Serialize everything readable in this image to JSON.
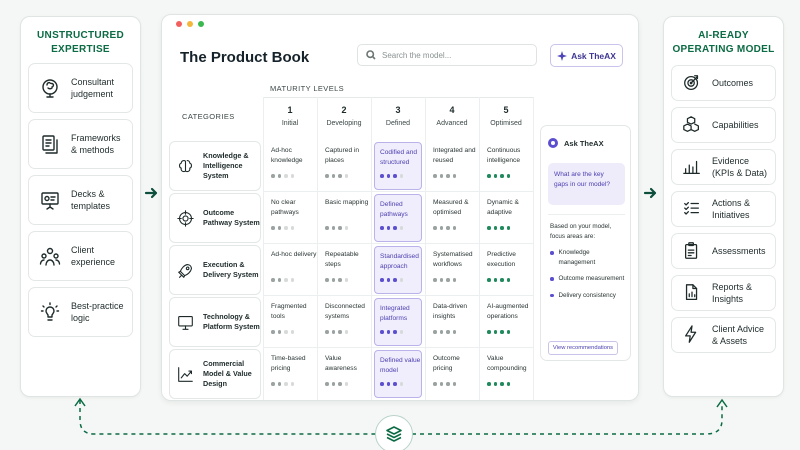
{
  "left_panel": {
    "title": "UNSTRUCTURED EXPERTISE",
    "items": [
      {
        "label": "Consultant judgement",
        "icon": "brain-head-icon"
      },
      {
        "label": "Frameworks & methods",
        "icon": "documents-icon"
      },
      {
        "label": "Decks & templates",
        "icon": "presentation-icon"
      },
      {
        "label": "Client experience",
        "icon": "people-icon"
      },
      {
        "label": "Best-practice logic",
        "icon": "lightbulb-icon"
      }
    ]
  },
  "right_panel": {
    "title": "AI-READY OPERATING MODEL",
    "items": [
      {
        "label": "Outcomes",
        "icon": "target-icon"
      },
      {
        "label": "Capabilities",
        "icon": "cubes-icon"
      },
      {
        "label": "Evidence (KPIs & Data)",
        "icon": "bar-chart-icon"
      },
      {
        "label": "Actions & Initiatives",
        "icon": "checklist-icon"
      },
      {
        "label": "Assessments",
        "icon": "clipboard-icon"
      },
      {
        "label": "Reports & Insights",
        "icon": "report-icon"
      },
      {
        "label": "Client Advice & Assets",
        "icon": "lightning-icon"
      }
    ]
  },
  "window": {
    "title": "The Product Book",
    "search_placeholder": "Search the model...",
    "ask_button": "Ask TheAX",
    "categories_header": "CATEGORIES",
    "maturity_header": "MATURITY LEVELS",
    "dot_colors": [
      "#f25f5c",
      "#f5b73b",
      "#3cb94e"
    ],
    "levels": [
      {
        "num": "1",
        "name": "Initial"
      },
      {
        "num": "2",
        "name": "Developing"
      },
      {
        "num": "3",
        "name": "Defined"
      },
      {
        "num": "4",
        "name": "Advanced"
      },
      {
        "num": "5",
        "name": "Optimised"
      }
    ],
    "highlight_level": 3,
    "rows": [
      {
        "category": "Knowledge & Intelligence System",
        "icon": "brain-icon",
        "cells": [
          "Ad-hoc knowledge",
          "Captured in places",
          "Codified and structured",
          "Integrated and reused",
          "Continuous intelligence"
        ]
      },
      {
        "category": "Outcome Pathway System",
        "icon": "crosshair-icon",
        "cells": [
          "No clear pathways",
          "Basic mapping",
          "Defined pathways",
          "Measured & optimised",
          "Dynamic & adaptive"
        ]
      },
      {
        "category": "Execution & Delivery System",
        "icon": "rocket-icon",
        "cells": [
          "Ad-hoc delivery",
          "Repeatable steps",
          "Standardised approach",
          "Systematised workflows",
          "Predictive execution"
        ]
      },
      {
        "category": "Technology & Platform System",
        "icon": "monitor-icon",
        "cells": [
          "Fragmented tools",
          "Disconnected systems",
          "Integrated platforms",
          "Data-driven insights",
          "AI-augmented operations"
        ]
      },
      {
        "category": "Commercial Model & Value Design",
        "icon": "trend-chart-icon",
        "cells": [
          "Time-based pricing",
          "Value awareness",
          "Defined value model",
          "Outcome pricing",
          "Value compounding"
        ]
      }
    ],
    "ask_panel": {
      "title": "Ask TheAX",
      "question": "What are the key gaps in our model?",
      "answer_intro": "Based on your model, focus areas are:",
      "focus_items": [
        "Knowledge management",
        "Outcome measurement",
        "Delivery consistency"
      ],
      "view_button": "View recommendations"
    }
  },
  "connector_icon": "layers-stack-icon"
}
